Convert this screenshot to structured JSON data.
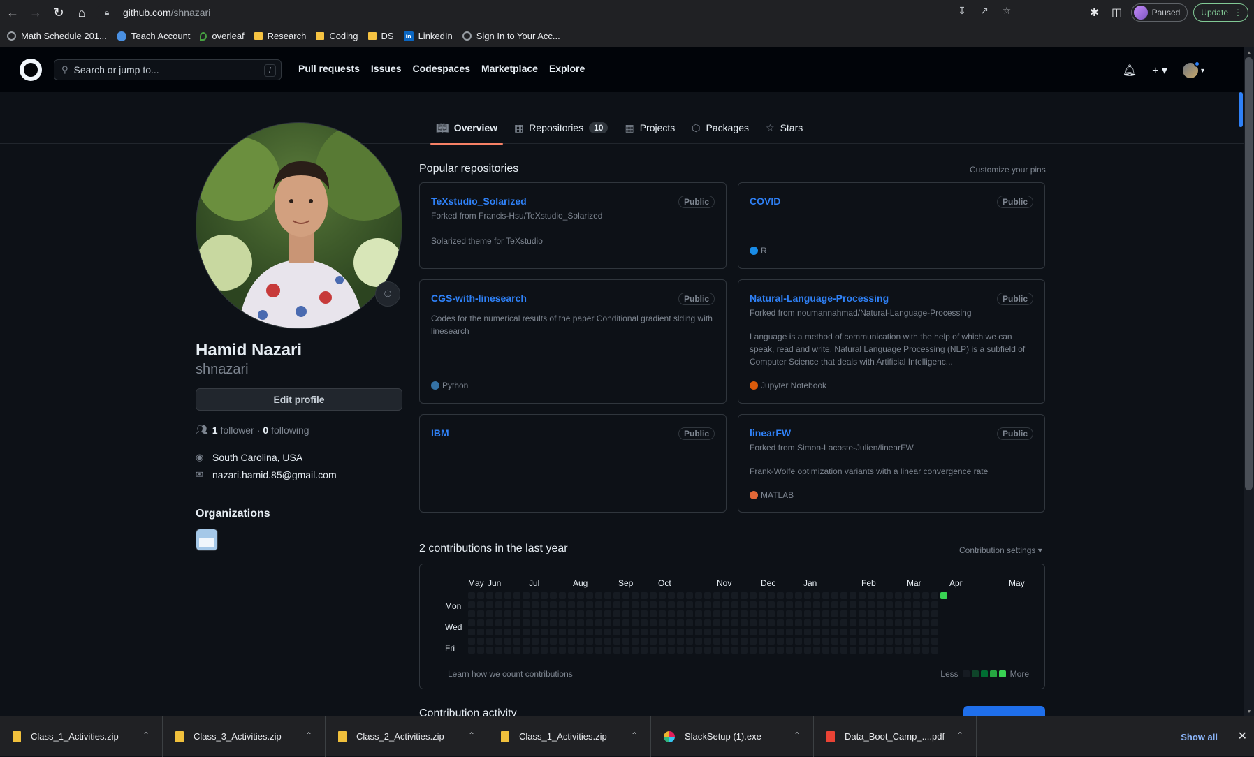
{
  "browser": {
    "url_host": "github.com",
    "url_path": "/shnazari",
    "paused_label": "Paused",
    "update_label": "Update",
    "bookmarks": [
      {
        "label": "Math Schedule 201...",
        "icon": "globe-icon"
      },
      {
        "label": "Teach Account",
        "icon": "blue-icon"
      },
      {
        "label": "overleaf",
        "icon": "overleaf-icon"
      },
      {
        "label": "Research",
        "icon": "folder-icon"
      },
      {
        "label": "Coding",
        "icon": "folder-icon"
      },
      {
        "label": "DS",
        "icon": "folder-icon"
      },
      {
        "label": "LinkedIn",
        "icon": "linkedin-icon"
      },
      {
        "label": "Sign In to Your Acc...",
        "icon": "globe-icon"
      }
    ]
  },
  "gh_header": {
    "search_placeholder": "Search or jump to...",
    "search_shortcut": "/",
    "nav": [
      "Pull requests",
      "Issues",
      "Codespaces",
      "Marketplace",
      "Explore"
    ]
  },
  "tabs": [
    {
      "label": "Overview",
      "icon": "book-icon",
      "active": true
    },
    {
      "label": "Repositories",
      "icon": "repo-icon",
      "count": "10"
    },
    {
      "label": "Projects",
      "icon": "table-icon"
    },
    {
      "label": "Packages",
      "icon": "package-icon"
    },
    {
      "label": "Stars",
      "icon": "star-icon"
    }
  ],
  "profile": {
    "name": "Hamid Nazari",
    "login": "shnazari",
    "edit_label": "Edit profile",
    "followers_count": "1",
    "followers_label": "follower",
    "following_count": "0",
    "following_label": "following",
    "location": "South Carolina, USA",
    "email": "nazari.hamid.85@gmail.com",
    "orgs_title": "Organizations"
  },
  "popular": {
    "title": "Popular repositories",
    "customize": "Customize your pins",
    "pins": [
      {
        "name": "TeXstudio_Solarized",
        "badge": "Public",
        "fork": "Forked from Francis-Hsu/TeXstudio_Solarized",
        "desc": "Solarized theme for TeXstudio",
        "lang": "",
        "lang_color": ""
      },
      {
        "name": "COVID",
        "badge": "Public",
        "fork": "",
        "desc": "",
        "lang": "R",
        "lang_color": "#198ce7"
      },
      {
        "name": "CGS-with-linesearch",
        "badge": "Public",
        "fork": "",
        "desc": "Codes for the numerical results of the paper Conditional gradient slding with linesearch",
        "lang": "Python",
        "lang_color": "#3572a5"
      },
      {
        "name": "Natural-Language-Processing",
        "badge": "Public",
        "fork": "Forked from noumannahmad/Natural-Language-Processing",
        "desc": "Language is a method of communication with the help of which we can speak, read and write. Natural Language Processing (NLP) is a subfield of Computer Science that deals with Artificial Intelligenc...",
        "lang": "Jupyter Notebook",
        "lang_color": "#da5b0b"
      },
      {
        "name": "IBM",
        "badge": "Public",
        "fork": "",
        "desc": "",
        "lang": "",
        "lang_color": ""
      },
      {
        "name": "linearFW",
        "badge": "Public",
        "fork": "Forked from Simon-Lacoste-Julien/linearFW",
        "desc": "Frank-Wolfe optimization variants with a linear convergence rate",
        "lang": "MATLAB",
        "lang_color": "#e16737"
      }
    ]
  },
  "contributions": {
    "title": "2 contributions in the last year",
    "settings": "Contribution settings ▾",
    "months": [
      "May",
      "Jun",
      "Jul",
      "Aug",
      "Sep",
      "Oct",
      "Nov",
      "Dec",
      "Jan",
      "Feb",
      "Mar",
      "Apr",
      "May"
    ],
    "days": [
      "Mon",
      "Wed",
      "Fri"
    ],
    "learn": "Learn how we count contributions",
    "less": "Less",
    "more": "More",
    "activity_title": "Contribution activity"
  },
  "downloads": {
    "items": [
      {
        "name": "Class_1_Activities.zip",
        "type": "zip"
      },
      {
        "name": "Class_3_Activities.zip",
        "type": "zip"
      },
      {
        "name": "Class_2_Activities.zip",
        "type": "zip"
      },
      {
        "name": "Class_1_Activities.zip",
        "type": "zip"
      },
      {
        "name": "SlackSetup (1).exe",
        "type": "exe"
      },
      {
        "name": "Data_Boot_Camp_....pdf",
        "type": "pdf"
      }
    ],
    "show_all": "Show all"
  }
}
